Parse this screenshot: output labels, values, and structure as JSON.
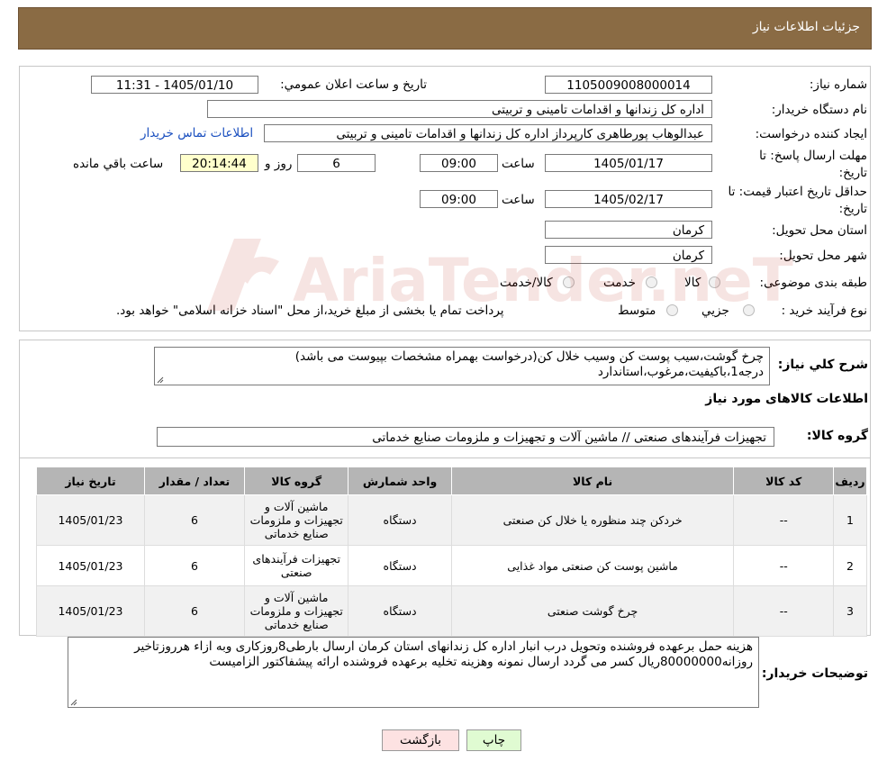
{
  "header": {
    "title": "جزئیات اطلاعات نیاز"
  },
  "form": {
    "need_number_label": "شماره نیاز:",
    "need_number": "1105009008000014",
    "announce_label": "تاریخ و ساعت اعلان عمومي:",
    "announce_value": "1405/01/10 - 11:31",
    "buyer_org_label": "نام دستگاه خريدار:",
    "buyer_org": "اداره کل زندانها و اقدامات تامینی و تربیتی",
    "creator_label": "ايجاد کننده درخواست:",
    "creator": "عبدالوهاب پورطاهری کارپرداز اداره کل زندانها و اقدامات تامینی و تربیتی",
    "contact_link": "اطلاعات تماس خريدار",
    "reply_deadline_label_1": "مهلت ارسال پاسخ: تا",
    "reply_deadline_label_2": "تاريخ:",
    "reply_date": "1405/01/17",
    "time_label": "ساعت",
    "reply_time": "09:00",
    "days": "6",
    "days_label": "روز و",
    "remaining_time": "20:14:44",
    "remaining_label": "ساعت باقي مانده",
    "price_valid_label_1": "حداقل تاريخ اعتبار قيمت: تا",
    "price_valid_label_2": "تاريخ:",
    "price_date": "1405/02/17",
    "price_time": "09:00",
    "province_label": "استان محل تحويل:",
    "province": "کرمان",
    "city_label": "شهر محل تحويل:",
    "city": "کرمان",
    "category_label": "طبقه بندی موضوعی:",
    "category_options": [
      "کالا",
      "خدمت",
      "کالا/خدمت"
    ],
    "process_label": "نوع فرآيند خريد :",
    "process_options": [
      "جزيي",
      "متوسط"
    ],
    "process_note": "پرداخت تمام يا بخشی از مبلغ خريد،از محل \"اسناد خزانه اسلامی\" خواهد بود."
  },
  "summary": {
    "label": "شرح کلي نياز:",
    "line1": "چرخ گوشت،سیب پوست کن وسیب خلال کن(درخواست بهمراه مشخصات بپیوست می باشد)",
    "line2": "درجه1،باکیفیت،مرغوب،استاندارد"
  },
  "goods": {
    "section_title": "اطلاعات کالاهای مورد نياز",
    "group_label": "گروه کالا:",
    "group_value": "تجهیزات فرآیندهای صنعتی // ماشین آلات و تجهیزات و ملزومات صنایع خدماتی",
    "columns": [
      "رديف",
      "کد کالا",
      "نام کالا",
      "واحد شمارش",
      "گروه کالا",
      "تعداد / مقدار",
      "تاريخ نياز"
    ],
    "rows": [
      {
        "row": "1",
        "code": "--",
        "name": "خردکن چند منظوره یا خلال کن صنعتی",
        "unit": "دستگاه",
        "group": "ماشین آلات و تجهیزات و ملزومات صنایع خدماتی",
        "qty": "6",
        "date": "1405/01/23"
      },
      {
        "row": "2",
        "code": "--",
        "name": "ماشین پوست کن صنعتی مواد غذایی",
        "unit": "دستگاه",
        "group": "تجهیزات فرآیندهای صنعتی",
        "qty": "6",
        "date": "1405/01/23"
      },
      {
        "row": "3",
        "code": "--",
        "name": "چرخ گوشت صنعتی",
        "unit": "دستگاه",
        "group": "ماشین آلات و تجهیزات و ملزومات صنایع خدماتی",
        "qty": "6",
        "date": "1405/01/23"
      }
    ]
  },
  "notes": {
    "label": "توضيحات خريدار:",
    "line1": "هزینه حمل برعهده فروشنده وتحویل درب انبار اداره کل زندانهای استان کرمان ارسال بارطی8روزکاری وبه ازاء هرروزتاخیر",
    "line2": "روزانه80000000ریال کسر می گردد ارسال نمونه وهزینه تخلیه برعهده فروشنده ارائه پیشفاکتور الزامیست"
  },
  "buttons": {
    "print": "چاپ",
    "back": "بازگشت"
  },
  "watermark": {
    "brand": "AriaTender.neT"
  },
  "colors": {
    "header": "#8a6b44",
    "link": "#1a4fbf",
    "back_button": "#fde2e2",
    "print_button": "#e0fbd2"
  }
}
